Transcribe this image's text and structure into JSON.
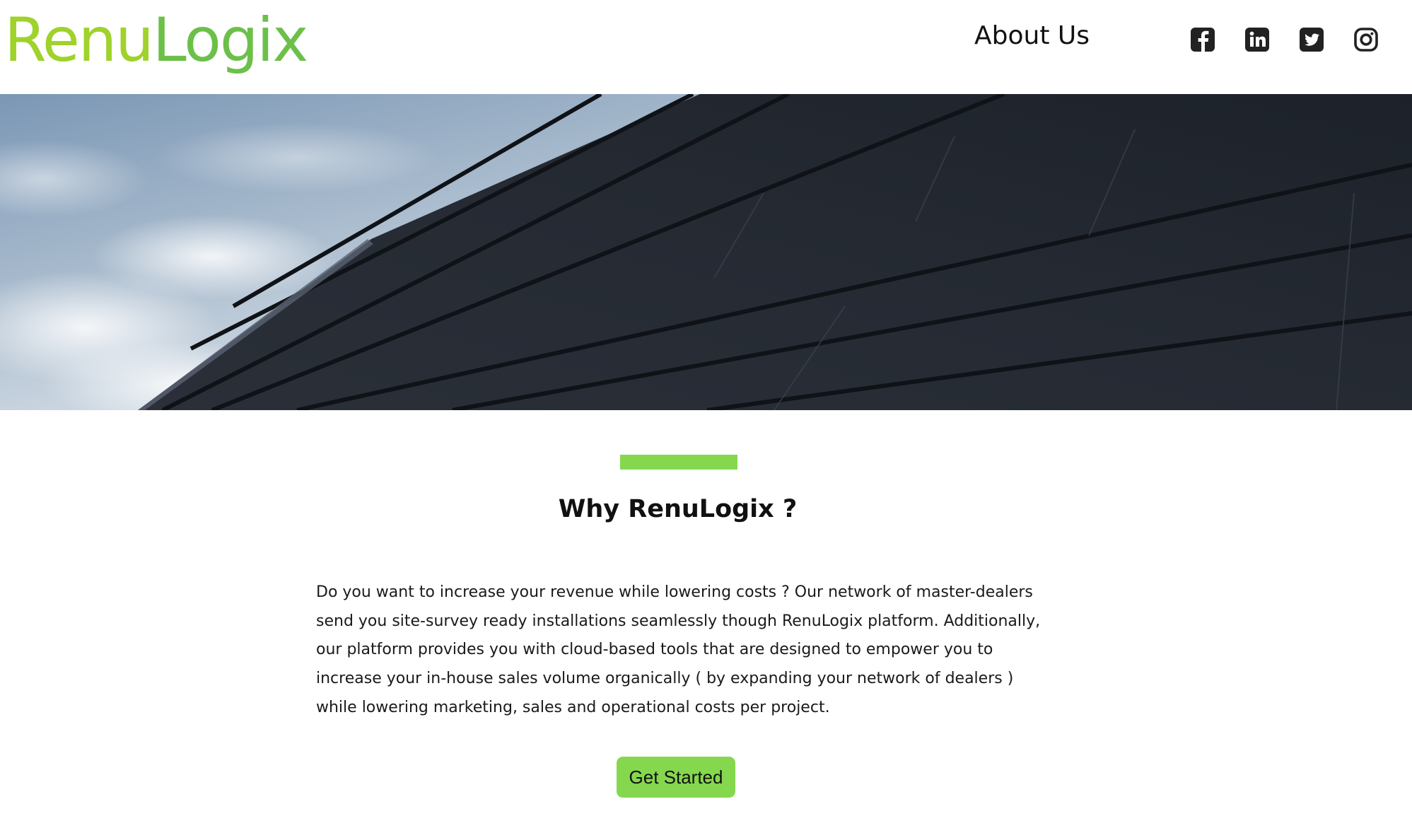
{
  "header": {
    "logo_part1": "Renu",
    "logo_part2": "Logix",
    "nav": {
      "about_label": "About Us"
    },
    "social": [
      {
        "icon": "facebook-icon"
      },
      {
        "icon": "linkedin-icon"
      },
      {
        "icon": "twitter-icon"
      },
      {
        "icon": "instagram-icon"
      }
    ]
  },
  "hero": {
    "image": "solar-roof-photo"
  },
  "main": {
    "title": "Why RenuLogix ?",
    "body": "Do you want to increase your revenue while lowering costs ? Our network of master-dealers send you site-survey ready installations seamlessly though RenuLogix platform. Additionally, our platform provides you with cloud-based tools that are designed to empower you to increase your in-house sales volume organically ( by expanding your network of dealers ) while lowering marketing, sales and operational costs per project.",
    "cta_label": "Get Started"
  },
  "colors": {
    "accent": "#85d84e",
    "logo_green_light": "#9fd22a",
    "logo_green": "#6cc04a",
    "text": "#111111"
  }
}
